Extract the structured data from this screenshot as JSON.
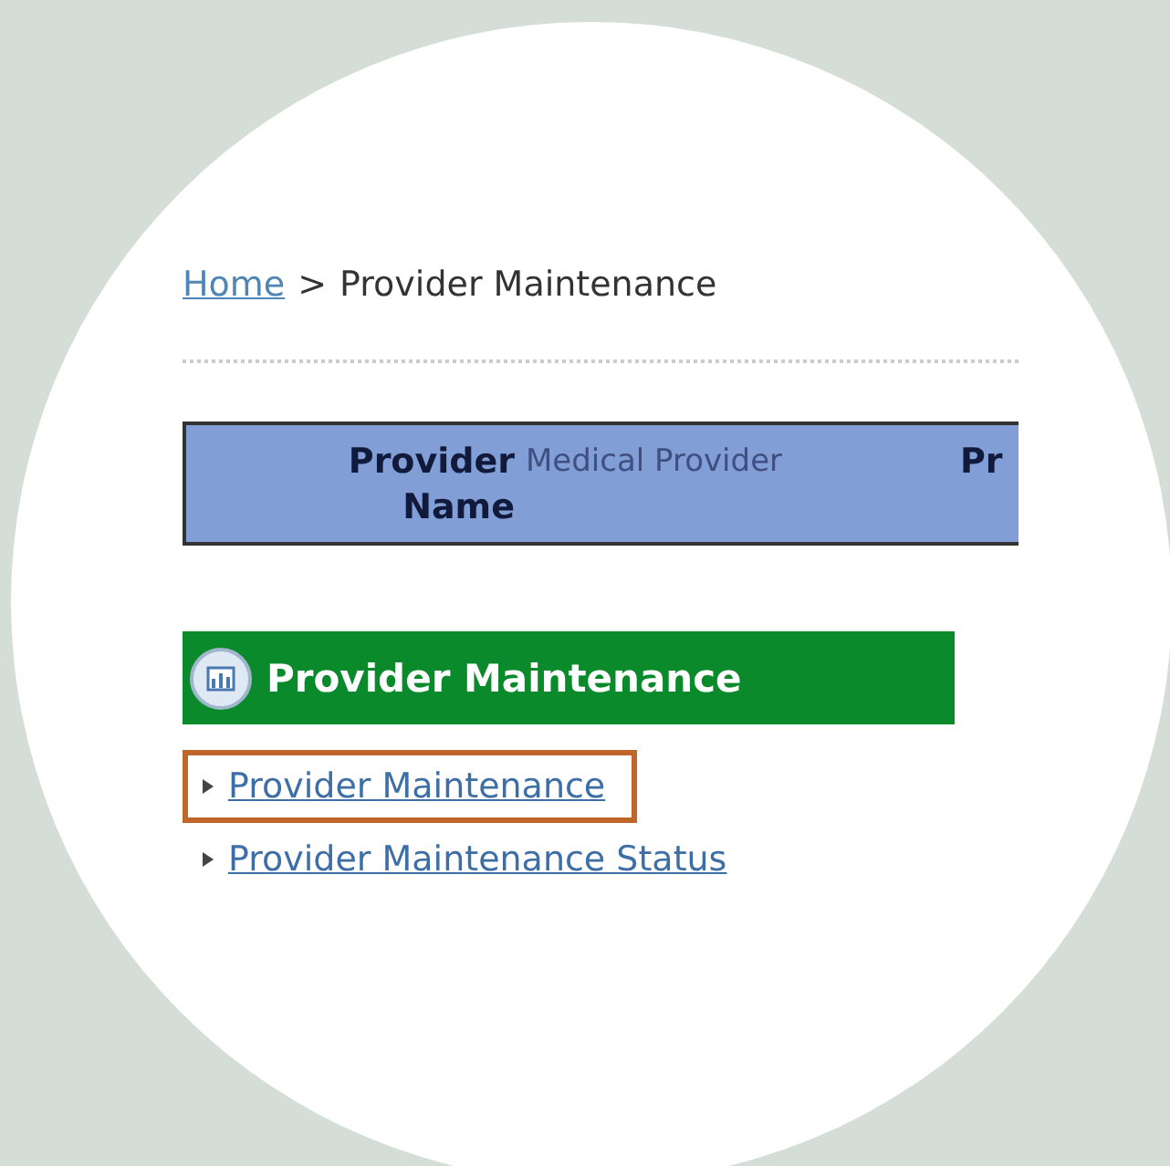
{
  "breadcrumb": {
    "link": "Home",
    "separator": ">",
    "current": "Provider Maintenance"
  },
  "header": {
    "label": "Provider Name",
    "value": "Medical Provider",
    "column_3": "Pr"
  },
  "panel": {
    "title": "Provider Maintenance",
    "links": [
      {
        "text": "Provider Maintenance",
        "highlighted": true
      },
      {
        "text": "Provider Maintenance Status",
        "highlighted": false
      }
    ]
  }
}
